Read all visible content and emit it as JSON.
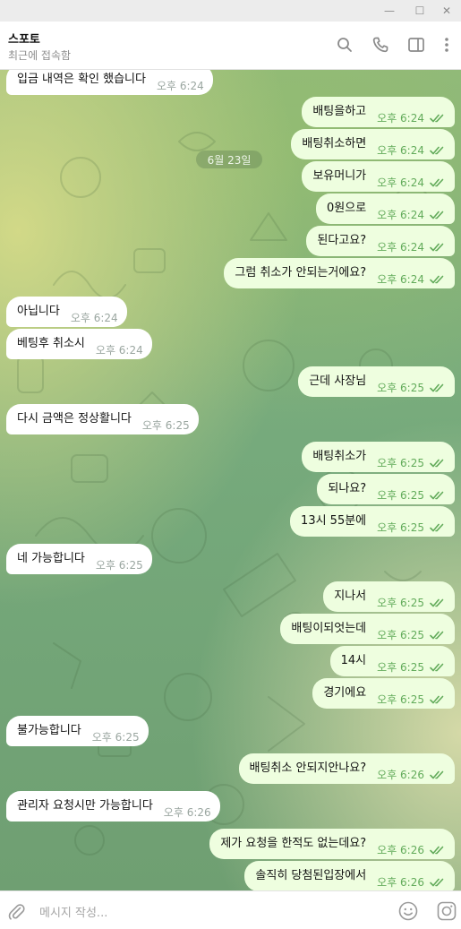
{
  "window": {
    "buttons": {
      "minimize": "—",
      "maximize": "☐",
      "close": "✕"
    }
  },
  "header": {
    "title": "스포토",
    "status": "최근에 접속함",
    "icons": [
      "search-icon",
      "phone-icon",
      "sidebar-toggle-icon",
      "more-vertical-icon"
    ]
  },
  "colors": {
    "outgoing_bubble": "#eefedf",
    "incoming_bubble": "#ffffff",
    "outgoing_time": "#62ab5a",
    "incoming_time": "#9aa6a0",
    "read_ticks": "#62ab5a"
  },
  "chat": {
    "date_label": "6월 23일",
    "messages": [
      {
        "dir": "in",
        "text": "입금 내역은 확인 했습니다",
        "time": "오후 6:24"
      },
      {
        "dir": "out",
        "text": "배팅을하고",
        "time": "오후 6:24",
        "read": true
      },
      {
        "dir": "out",
        "text": "배팅취소하면",
        "time": "오후 6:24",
        "read": true
      },
      {
        "dir": "out",
        "text": "보유머니가",
        "time": "오후 6:24",
        "read": true
      },
      {
        "dir": "out",
        "text": "0원으로",
        "time": "오후 6:24",
        "read": true
      },
      {
        "dir": "out",
        "text": "된다고요?",
        "time": "오후 6:24",
        "read": true
      },
      {
        "dir": "out",
        "text": "그럼 취소가 안되는거에요?",
        "time": "오후 6:24",
        "read": true
      },
      {
        "dir": "in",
        "text": "아닙니다",
        "time": "오후 6:24"
      },
      {
        "dir": "in",
        "text": "베팅후 취소시",
        "time": "오후 6:24"
      },
      {
        "dir": "out",
        "text": "근데 사장님",
        "time": "오후 6:25",
        "read": true
      },
      {
        "dir": "in",
        "text": "다시 금액은 정상활니다",
        "time": "오후 6:25"
      },
      {
        "dir": "out",
        "text": "배팅취소가",
        "time": "오후 6:25",
        "read": true
      },
      {
        "dir": "out",
        "text": "되나요?",
        "time": "오후 6:25",
        "read": true
      },
      {
        "dir": "out",
        "text": "13시 55분에",
        "time": "오후 6:25",
        "read": true
      },
      {
        "dir": "in",
        "text": "네 가능합니다",
        "time": "오후 6:25"
      },
      {
        "dir": "out",
        "text": "지나서",
        "time": "오후 6:25",
        "read": true
      },
      {
        "dir": "out",
        "text": "배팅이되엇는데",
        "time": "오후 6:25",
        "read": true
      },
      {
        "dir": "out",
        "text": "14시",
        "time": "오후 6:25",
        "read": true
      },
      {
        "dir": "out",
        "text": "경기에요",
        "time": "오후 6:25",
        "read": true
      },
      {
        "dir": "in",
        "text": "불가능합니다",
        "time": "오후 6:25"
      },
      {
        "dir": "out",
        "text": "배팅취소 안되지안나요?",
        "time": "오후 6:26",
        "read": true
      },
      {
        "dir": "in",
        "text": "관리자 요청시만 가능합니다",
        "time": "오후 6:26"
      },
      {
        "dir": "out",
        "text": "제가 요청을 한적도 없는데요?",
        "time": "오후 6:26",
        "read": true
      },
      {
        "dir": "out",
        "text": "솔직히 당첨된입장에서",
        "time": "오후 6:26",
        "read": true
      }
    ]
  },
  "composer": {
    "placeholder": "메시지 작성...",
    "icons": [
      "attach-icon",
      "emoji-icon",
      "camera-icon"
    ]
  }
}
